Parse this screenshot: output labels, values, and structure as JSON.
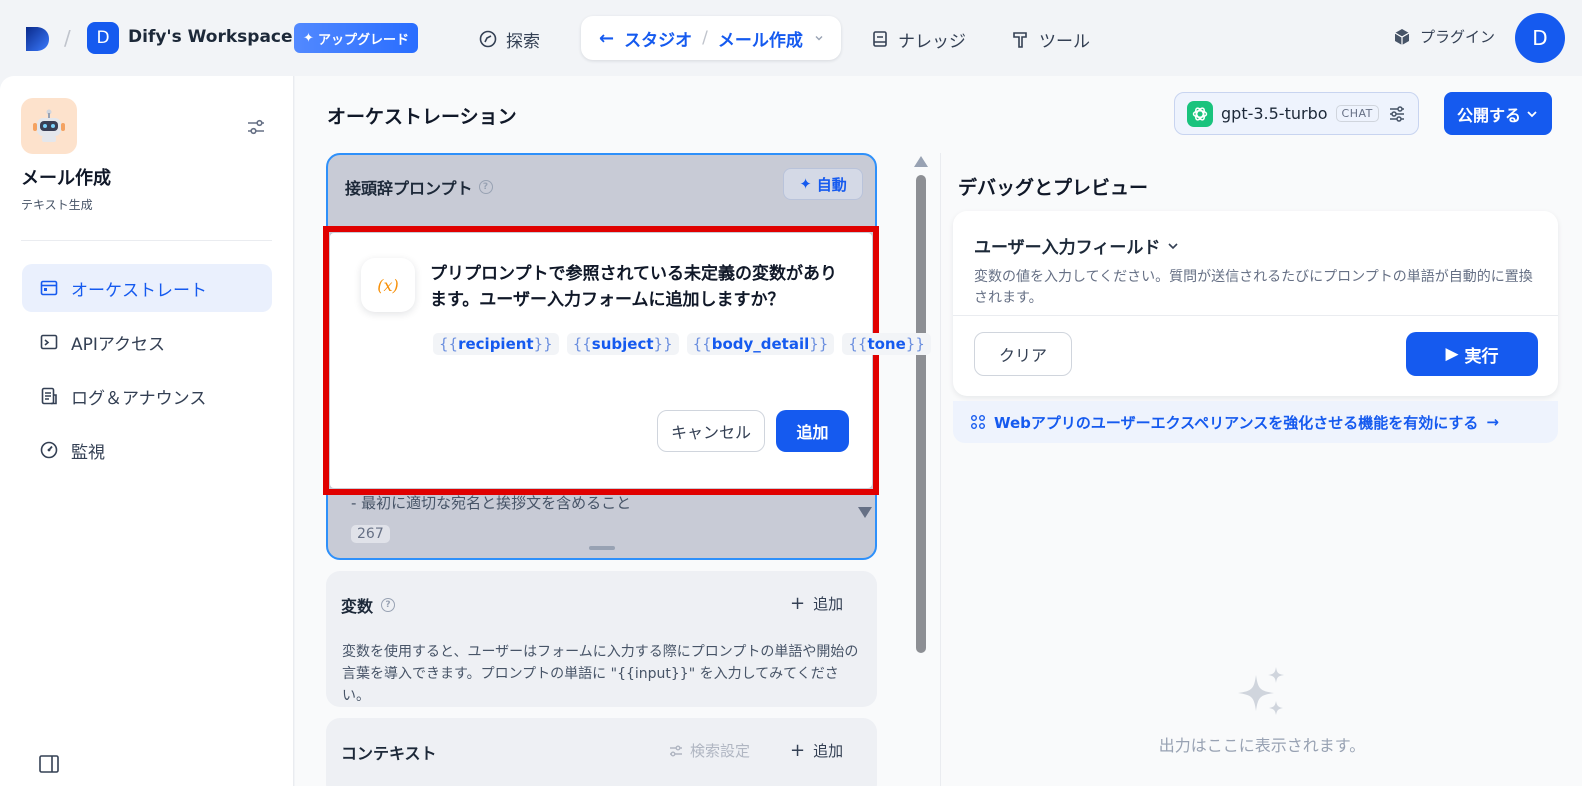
{
  "topbar": {
    "workspace_initial": "D",
    "workspace_name": "Dify's Workspace",
    "upgrade_label": "アップグレード",
    "nav_explore": "探索",
    "nav_studio": "スタジオ",
    "nav_current_app": "メール作成",
    "nav_knowledge": "ナレッジ",
    "nav_tools": "ツール",
    "plugin_label": "プラグイン",
    "user_initial": "D"
  },
  "sidebar": {
    "app_name": "メール作成",
    "app_type": "テキスト生成",
    "items": [
      {
        "label": "オーケストレート",
        "icon": "window-icon",
        "active": true
      },
      {
        "label": "APIアクセス",
        "icon": "terminal-icon",
        "active": false
      },
      {
        "label": "ログ＆アナウンス",
        "icon": "document-icon",
        "active": false
      },
      {
        "label": "監視",
        "icon": "gauge-icon",
        "active": false
      }
    ]
  },
  "main": {
    "title": "オーケストレーション",
    "model_name": "gpt-3.5-turbo",
    "model_mode": "CHAT",
    "publish_label": "公開する"
  },
  "prompt": {
    "title": "接頭辞プロンプト",
    "auto_label": "自動",
    "visible_line": "- 最初に適切な宛名と挨拶文を含めること",
    "char_count": "267"
  },
  "variables": {
    "title": "変数",
    "add_label": "追加",
    "description": "変数を使用すると、ユーザーはフォームに入力する際にプロンプトの単語や開始の言葉を導入できます。プロンプトの単語に \"{{input}}\" を入力してみてください。"
  },
  "context": {
    "title": "コンテキスト",
    "retrieval_label": "検索設定",
    "add_label": "追加"
  },
  "debug": {
    "title": "デバッグとプレビュー",
    "input_title": "ユーザー入力フィールド",
    "input_description": "変数の値を入力してください。質問が送信されるたびにプロンプトの単語が自動的に置換されます。",
    "clear_label": "クリア",
    "run_label": "実行",
    "banner_text": "Webアプリのユーザーエクスペリアンスを強化させる機能を有効にする",
    "empty_text": "出力はここに表示されます。"
  },
  "modal": {
    "icon_text": "(x)",
    "message": "プリプロンプトで参照されている未定義の変数があります。ユーザー入力フォームに追加しますか？",
    "variables": [
      "recipient",
      "subject",
      "body_detail",
      "tone"
    ],
    "cancel_label": "キャンセル",
    "add_label": "追加"
  },
  "colors": {
    "accent": "#155aef",
    "highlight_outline": "#e00000"
  }
}
